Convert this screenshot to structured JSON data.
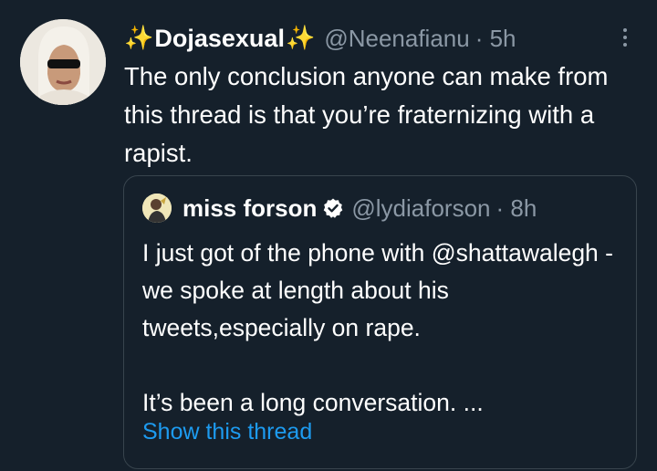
{
  "tweet": {
    "display_name": "Dojasexual",
    "name_emoji": "✨",
    "handle": "@Neenafianu",
    "time": "· 5h",
    "text": "The only conclusion anyone can make from this thread is that you’re fraternizing with a rapist."
  },
  "quote": {
    "display_name": "miss forson",
    "handle": "@lydiaforson",
    "time": "· 8h",
    "paragraph_1": "I just got of the phone with @shattawalegh -we spoke at length about his tweets,especially on rape.",
    "paragraph_2": "It’s been a long conversation. ...",
    "show_thread": "Show this thread"
  },
  "colors": {
    "background": "#15202b",
    "text": "#ffffff",
    "secondary": "#8b98a5",
    "link": "#1d9bf0",
    "border": "#38444d",
    "sparkle": "#ffd84d"
  },
  "icons": {
    "more": "more-vertical-icon",
    "verified": "verified-badge-icon",
    "sparkle": "sparkles-icon"
  }
}
